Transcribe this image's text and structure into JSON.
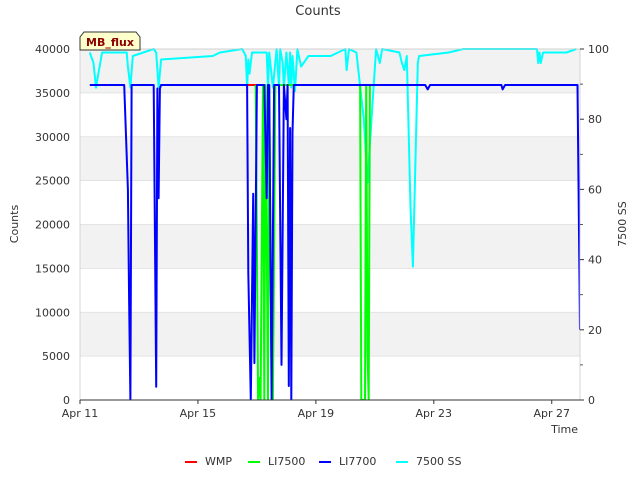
{
  "chart_data": {
    "type": "line",
    "title": "Counts",
    "xlabel": "Time",
    "ylabel_left": "Counts",
    "ylabel_right": "7500 SS",
    "site_badge": "MB_flux",
    "x_domain": [
      "2024-04-11",
      "2024-04-27T23:00"
    ],
    "x_ticks": [
      {
        "date": "2024-04-11",
        "label": "Apr 11"
      },
      {
        "date": "2024-04-15",
        "label": "Apr 15"
      },
      {
        "date": "2024-04-19",
        "label": "Apr 19"
      },
      {
        "date": "2024-04-23",
        "label": "Apr 23"
      },
      {
        "date": "2024-04-27",
        "label": "Apr 27"
      }
    ],
    "ylim_left": [
      0,
      40000
    ],
    "yticks_left": [
      0,
      5000,
      10000,
      15000,
      20000,
      25000,
      30000,
      35000,
      40000
    ],
    "ylim_right": [
      0,
      100
    ],
    "yticks_right": [
      0,
      20,
      40,
      60,
      80,
      100
    ],
    "grid": "horizontal bands",
    "legend_position": "bottom",
    "series": [
      {
        "name": "WMP",
        "color": "#ff0000",
        "axis": "left",
        "points": [
          [
            "2024-04-16T06:00",
            35900
          ],
          [
            "2024-04-17T00:00",
            35900
          ]
        ]
      },
      {
        "name": "LI7500",
        "color": "#00ff00",
        "axis": "left",
        "points": [
          [
            "2024-04-16T23:00",
            35900
          ],
          [
            "2024-04-17T01:00",
            0
          ],
          [
            "2024-04-17T02:00",
            2500
          ],
          [
            "2024-04-17T03:00",
            0
          ],
          [
            "2024-04-17T05:00",
            35900
          ],
          [
            "2024-04-17T06:00",
            0
          ],
          [
            "2024-04-17T07:00",
            35900
          ],
          [
            "2024-04-17T09:00",
            0
          ],
          [
            "2024-04-17T10:00",
            35900
          ],
          [
            "2024-04-17T12:00",
            2500
          ],
          [
            "2024-04-17T13:00",
            0
          ],
          [
            "2024-04-17T15:00",
            35900
          ],
          [
            "2024-04-20T12:00",
            35900
          ],
          [
            "2024-04-20T13:00",
            0
          ],
          [
            "2024-04-20T16:00",
            0
          ],
          [
            "2024-04-20T17:00",
            35900
          ],
          [
            "2024-04-20T18:00",
            5300
          ],
          [
            "2024-04-20T19:00",
            0
          ],
          [
            "2024-04-20T20:00",
            35900
          ]
        ]
      },
      {
        "name": "LI7700",
        "color": "#0000ff",
        "axis": "left",
        "points": [
          [
            "2024-04-11T08:00",
            35900
          ],
          [
            "2024-04-12T12:00",
            35900
          ],
          [
            "2024-04-12T15:00",
            24000
          ],
          [
            "2024-04-12T16:00",
            11500
          ],
          [
            "2024-04-12T17:00",
            0
          ],
          [
            "2024-04-12T18:00",
            35900
          ],
          [
            "2024-04-13T12:00",
            35900
          ],
          [
            "2024-04-13T14:00",
            1500
          ],
          [
            "2024-04-13T15:00",
            35500
          ],
          [
            "2024-04-13T16:00",
            23000
          ],
          [
            "2024-04-13T17:00",
            35500
          ],
          [
            "2024-04-13T18:00",
            35900
          ],
          [
            "2024-04-16T16:00",
            35900
          ],
          [
            "2024-04-16T17:00",
            14500
          ],
          [
            "2024-04-16T19:00",
            0
          ],
          [
            "2024-04-16T21:00",
            23500
          ],
          [
            "2024-04-16T22:00",
            4200
          ],
          [
            "2024-04-17T00:00",
            35900
          ],
          [
            "2024-04-17T06:00",
            35900
          ],
          [
            "2024-04-17T08:00",
            23000
          ],
          [
            "2024-04-17T09:00",
            35900
          ],
          [
            "2024-04-17T10:00",
            35900
          ],
          [
            "2024-04-17T12:00",
            0
          ],
          [
            "2024-04-17T14:00",
            35900
          ],
          [
            "2024-04-17T18:00",
            35900
          ],
          [
            "2024-04-17T20:00",
            4000
          ],
          [
            "2024-04-17T22:00",
            35900
          ],
          [
            "2024-04-18T00:00",
            32000
          ],
          [
            "2024-04-18T01:00",
            35900
          ],
          [
            "2024-04-18T02:00",
            1600
          ],
          [
            "2024-04-18T03:00",
            31000
          ],
          [
            "2024-04-18T04:00",
            0
          ],
          [
            "2024-04-18T05:00",
            30500
          ],
          [
            "2024-04-18T06:00",
            35900
          ],
          [
            "2024-04-22T17:00",
            35900
          ],
          [
            "2024-04-22T19:00",
            35400
          ],
          [
            "2024-04-22T21:00",
            35900
          ],
          [
            "2024-04-25T07:00",
            35900
          ],
          [
            "2024-04-25T08:00",
            35400
          ],
          [
            "2024-04-25T10:00",
            35900
          ],
          [
            "2024-04-27T21:00",
            35900
          ],
          [
            "2024-04-27T23:00",
            8000
          ]
        ]
      },
      {
        "name": "7500 SS",
        "color": "#00ffff",
        "axis": "right",
        "points": [
          [
            "2024-04-11T08:00",
            99
          ],
          [
            "2024-04-11T11:00",
            96
          ],
          [
            "2024-04-11T13:00",
            89
          ],
          [
            "2024-04-11T15:00",
            93
          ],
          [
            "2024-04-11T18:00",
            99
          ],
          [
            "2024-04-12T14:00",
            99
          ],
          [
            "2024-04-12T15:00",
            95
          ],
          [
            "2024-04-12T17:00",
            89
          ],
          [
            "2024-04-12T19:00",
            98
          ],
          [
            "2024-04-13T12:00",
            100
          ],
          [
            "2024-04-13T14:00",
            99
          ],
          [
            "2024-04-13T16:00",
            89
          ],
          [
            "2024-04-13T18:00",
            97
          ],
          [
            "2024-04-15T12:00",
            98
          ],
          [
            "2024-04-15T18:00",
            99
          ],
          [
            "2024-04-16T12:00",
            100
          ],
          [
            "2024-04-16T15:00",
            98
          ],
          [
            "2024-04-16T16:00",
            89
          ],
          [
            "2024-04-16T17:00",
            97
          ],
          [
            "2024-04-16T18:00",
            93
          ],
          [
            "2024-04-16T20:00",
            99
          ],
          [
            "2024-04-17T08:00",
            99
          ],
          [
            "2024-04-17T09:00",
            89
          ],
          [
            "2024-04-17T10:00",
            99
          ],
          [
            "2024-04-17T13:00",
            89
          ],
          [
            "2024-04-17T16:00",
            100
          ],
          [
            "2024-04-17T18:00",
            89
          ],
          [
            "2024-04-17T19:00",
            100
          ],
          [
            "2024-04-17T21:00",
            96
          ],
          [
            "2024-04-17T22:00",
            89
          ],
          [
            "2024-04-18T00:00",
            99
          ],
          [
            "2024-04-18T02:00",
            90
          ],
          [
            "2024-04-18T03:00",
            99
          ],
          [
            "2024-04-18T04:00",
            89
          ],
          [
            "2024-04-18T05:00",
            98
          ],
          [
            "2024-04-18T07:00",
            88
          ],
          [
            "2024-04-18T09:00",
            100
          ],
          [
            "2024-04-18T12:00",
            95
          ],
          [
            "2024-04-18T18:00",
            98
          ],
          [
            "2024-04-19T12:00",
            98
          ],
          [
            "2024-04-19T18:00",
            99
          ],
          [
            "2024-04-20T00:00",
            100
          ],
          [
            "2024-04-20T01:00",
            94
          ],
          [
            "2024-04-20T03:00",
            100
          ],
          [
            "2024-04-20T09:00",
            99
          ],
          [
            "2024-04-20T15:00",
            80
          ],
          [
            "2024-04-20T18:00",
            62
          ],
          [
            "2024-04-20T22:00",
            84
          ],
          [
            "2024-04-21T01:00",
            100
          ],
          [
            "2024-04-21T04:00",
            96
          ],
          [
            "2024-04-21T06:00",
            100
          ],
          [
            "2024-04-21T20:00",
            99
          ],
          [
            "2024-04-21T22:00",
            96
          ],
          [
            "2024-04-22T00:00",
            94
          ],
          [
            "2024-04-22T02:00",
            98
          ],
          [
            "2024-04-22T05:00",
            55
          ],
          [
            "2024-04-22T07:00",
            38
          ],
          [
            "2024-04-22T11:00",
            96
          ],
          [
            "2024-04-22T12:00",
            98
          ],
          [
            "2024-04-23T12:00",
            99
          ],
          [
            "2024-04-24T00:00",
            100
          ],
          [
            "2024-04-26T12:00",
            100
          ],
          [
            "2024-04-26T13:00",
            96
          ],
          [
            "2024-04-26T14:00",
            99
          ],
          [
            "2024-04-26T15:00",
            96
          ],
          [
            "2024-04-26T17:00",
            99
          ],
          [
            "2024-04-27T12:00",
            99
          ],
          [
            "2024-04-27T20:00",
            100
          ]
        ]
      }
    ]
  }
}
